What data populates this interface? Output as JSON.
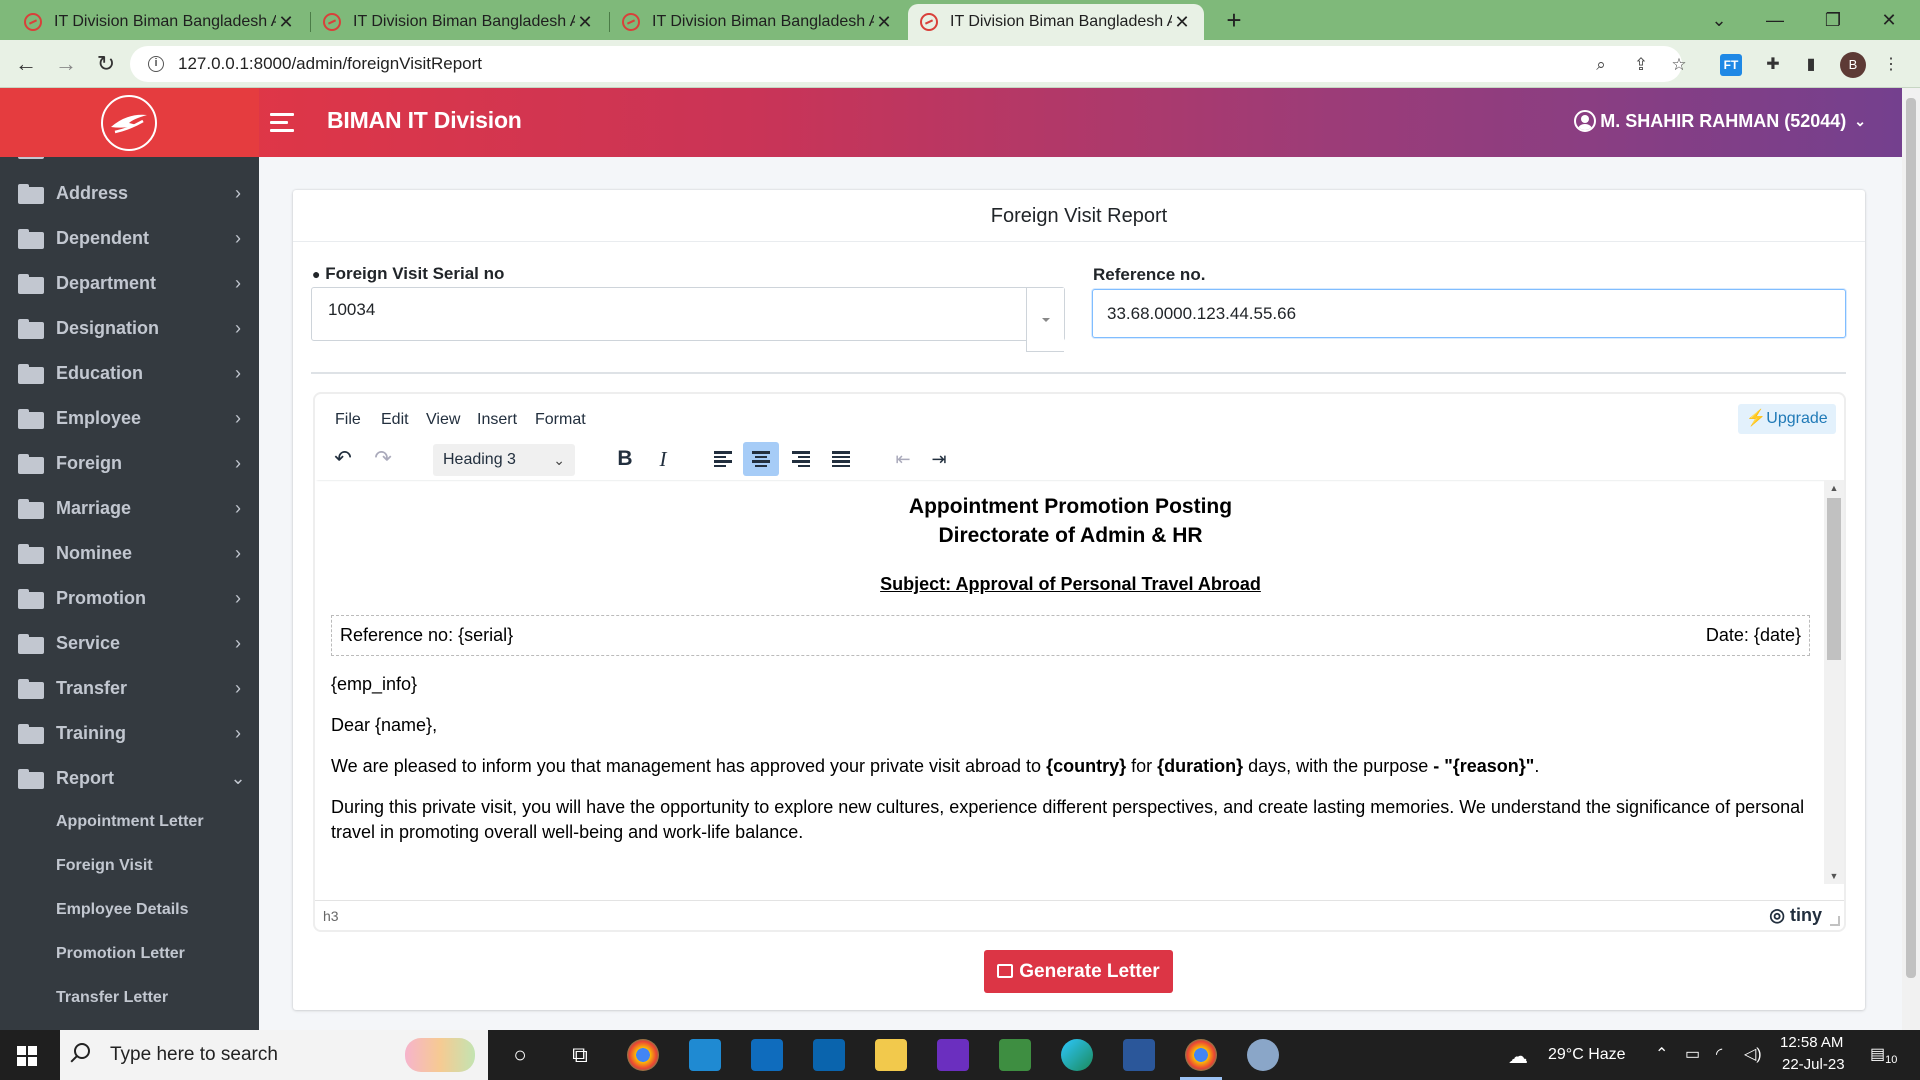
{
  "browser": {
    "tabs": [
      {
        "title": "IT Division Biman Bangladesh Air",
        "active": false
      },
      {
        "title": "IT Division Biman Bangladesh Air",
        "active": false
      },
      {
        "title": "IT Division Biman Bangladesh Air",
        "active": false
      },
      {
        "title": "IT Division Biman Bangladesh Air",
        "active": true
      }
    ],
    "new_tab": "+",
    "url": "127.0.0.1:8000/admin/foreignVisitReport",
    "profile_initial": "B",
    "ext_ft": "FT"
  },
  "header": {
    "title": "BIMAN IT Division",
    "user": "M. SHAHIR RAHMAN (52044)"
  },
  "sidebar": {
    "items": [
      {
        "label": "Address",
        "arrow": "›"
      },
      {
        "label": "Dependent",
        "arrow": "›"
      },
      {
        "label": "Department",
        "arrow": "›"
      },
      {
        "label": "Designation",
        "arrow": "›"
      },
      {
        "label": "Education",
        "arrow": "›"
      },
      {
        "label": "Employee",
        "arrow": "›"
      },
      {
        "label": "Foreign",
        "arrow": "›"
      },
      {
        "label": "Marriage",
        "arrow": "›"
      },
      {
        "label": "Nominee",
        "arrow": "›"
      },
      {
        "label": "Promotion",
        "arrow": "›"
      },
      {
        "label": "Service",
        "arrow": "›"
      },
      {
        "label": "Transfer",
        "arrow": "›"
      },
      {
        "label": "Training",
        "arrow": "›"
      },
      {
        "label": "Report",
        "arrow": "⌄"
      }
    ],
    "report_children": [
      "Appointment Letter",
      "Foreign Visit",
      "Employee Details",
      "Promotion Letter",
      "Transfer Letter"
    ]
  },
  "form": {
    "card_title": "Foreign Visit Report",
    "serial_label": "Foreign Visit Serial no",
    "serial_value": "10034",
    "reference_label": "Reference no.",
    "reference_value": "33.68.0000.123.44.55.66"
  },
  "editor": {
    "menu": [
      "File",
      "Edit",
      "View",
      "Insert",
      "Format"
    ],
    "upgrade": "Upgrade",
    "block_format": "Heading 3",
    "status_path": "h3",
    "brand": "tiny",
    "doc": {
      "heading_line1": "Appointment Promotion Posting",
      "heading_line2": "Directorate of Admin & HR",
      "subject": "Subject: Approval of Personal Travel Abroad",
      "ref_left": "Reference no: {serial}",
      "ref_right": "Date: {date}",
      "emp_info": "{emp_info}",
      "greeting": "Dear {name},",
      "p1_a": "We are pleased to inform you that management has approved your private visit abroad to ",
      "p1_country": "{country}",
      "p1_b": " for ",
      "p1_duration": "{duration}",
      "p1_c": " days, with the purpose ",
      "p1_reason": "- \"{reason}\"",
      "p1_d": ".",
      "p2": "During this private visit, you will have the opportunity to explore new cultures, experience different perspectives, and create lasting memories. We understand the significance of personal travel in promoting overall well-being and work-life balance."
    }
  },
  "generate_button": "Generate Letter",
  "taskbar": {
    "search_placeholder": "Type here to search",
    "weather": "29°C  Haze",
    "time": "12:58 AM",
    "date": "22-Jul-23",
    "notifications": "10"
  },
  "colors": {
    "sidebar_bg": "#343a40",
    "header_start": "#e9383f",
    "header_end": "#74408e",
    "danger": "#dc3545",
    "tab_bar": "#7fb97a"
  }
}
